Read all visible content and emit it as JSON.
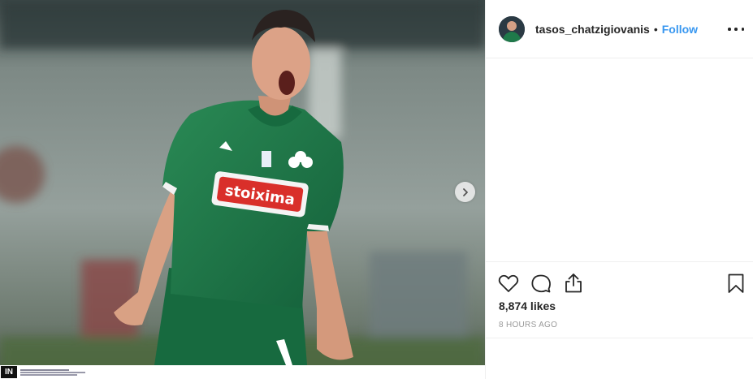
{
  "post": {
    "author": {
      "username": "tasos_chatzigiovanis",
      "separator": "•",
      "follow_label": "Follow",
      "avatar_icon": "profile-photo"
    },
    "media": {
      "description_icon": "photo",
      "carousel_next_icon": "chevron-right-icon",
      "credit_logo": "IN"
    },
    "actions": {
      "like_icon": "heart-outline-icon",
      "comment_icon": "comment-bubble-icon",
      "share_icon": "share-upload-icon",
      "save_icon": "bookmark-icon"
    },
    "likes_text": "8,874 likes",
    "timestamp": "8 HOURS AGO",
    "colors": {
      "link_blue": "#3897f0",
      "text_dark": "#262626",
      "text_muted": "#999999",
      "border": "#efefef",
      "jersey_green": "#1f7a4a"
    }
  }
}
